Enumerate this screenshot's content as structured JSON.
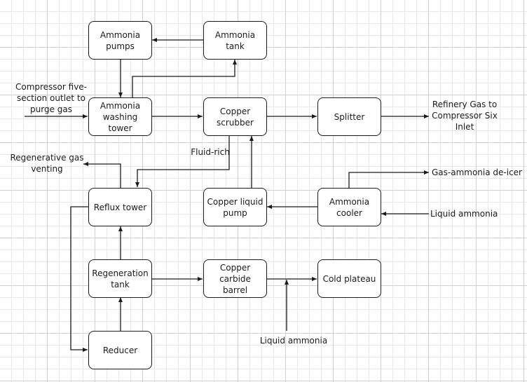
{
  "diagram": {
    "type": "process-flow",
    "nodes": {
      "ammonia_pumps": "Ammonia pumps",
      "ammonia_tank": "Ammonia tank",
      "ammonia_washing_tower": "Ammonia washing tower",
      "copper_scrubber": "Copper scrubber",
      "splitter": "Splitter",
      "reflux_tower": "Reflux tower",
      "copper_liquid_pump": "Copper liquid pump",
      "ammonia_cooler": "Ammonia cooler",
      "regeneration_tank": "Regeneration tank",
      "copper_carbide_barrel": "Copper carbide barrel",
      "cold_plateau": "Cold plateau",
      "reducer": "Reducer"
    },
    "labels": {
      "compressor_inlet": "Compressor five-\nsection outlet to\npurge gas",
      "refinery_gas": "Refinery Gas to\nCompressor Six\nInlet",
      "regenerative_gas": "Regenerative gas\nventing",
      "fluid_rich": "Fluid-rich",
      "gas_ammonia_deicer": "Gas-ammonia de-icer",
      "liquid_ammonia_cooler": "Liquid ammonia",
      "liquid_ammonia_bottom": "Liquid ammonia"
    },
    "edges": [
      {
        "from": "Ammonia tank",
        "to": "Ammonia pumps"
      },
      {
        "from": "Ammonia pumps",
        "to": "Ammonia washing tower"
      },
      {
        "from": "Ammonia washing tower",
        "to": "Ammonia tank"
      },
      {
        "from": "Compressor five-section outlet to purge gas",
        "to": "Ammonia washing tower"
      },
      {
        "from": "Ammonia washing tower",
        "to": "Copper scrubber"
      },
      {
        "from": "Copper scrubber",
        "to": "Splitter"
      },
      {
        "from": "Splitter",
        "to": "Refinery Gas to Compressor Six Inlet"
      },
      {
        "from": "Copper scrubber",
        "to": "Reflux tower",
        "label": "Fluid-rich"
      },
      {
        "from": "Reflux tower",
        "to": "Regenerative gas venting"
      },
      {
        "from": "Copper liquid pump",
        "to": "Copper scrubber"
      },
      {
        "from": "Ammonia cooler",
        "to": "Copper liquid pump"
      },
      {
        "from": "Ammonia cooler",
        "to": "Gas-ammonia de-icer"
      },
      {
        "from": "Liquid ammonia",
        "to": "Ammonia cooler"
      },
      {
        "from": "Reflux tower",
        "to": "Reducer"
      },
      {
        "from": "Reducer",
        "to": "Regeneration tank"
      },
      {
        "from": "Regeneration tank",
        "to": "Reflux tower"
      },
      {
        "from": "Regeneration tank",
        "to": "Copper carbide barrel"
      },
      {
        "from": "Copper carbide barrel",
        "to": "Cold plateau"
      },
      {
        "from": "Liquid ammonia",
        "to": "Copper carbide barrel / Cold plateau line"
      }
    ]
  }
}
